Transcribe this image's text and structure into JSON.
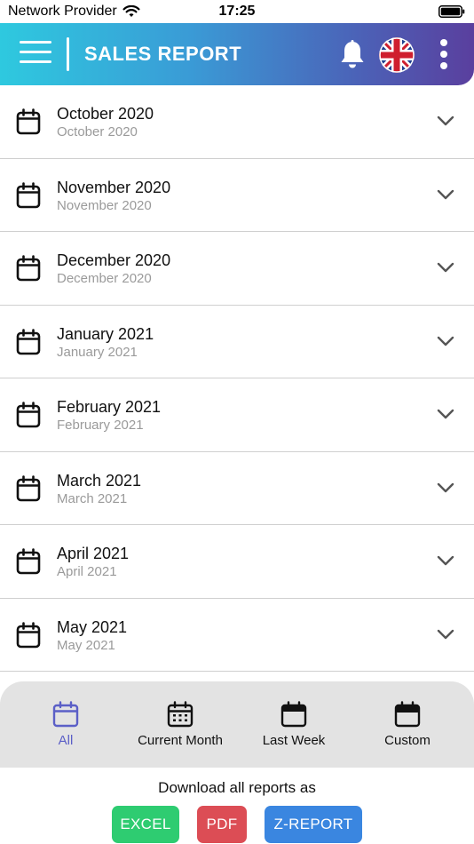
{
  "status": {
    "carrier": "Network Provider",
    "time": "17:25"
  },
  "header": {
    "title": "SALES REPORT",
    "menu_icon": "hamburger-menu-icon",
    "notify_icon": "bell-icon",
    "language_icon": "uk-flag-icon",
    "more_icon": "kebab-icon"
  },
  "reports": [
    {
      "title": "October 2020",
      "subtitle": "October 2020"
    },
    {
      "title": "November 2020",
      "subtitle": "November 2020"
    },
    {
      "title": "December 2020",
      "subtitle": "December 2020"
    },
    {
      "title": "January 2021",
      "subtitle": "January 2021"
    },
    {
      "title": "February 2021",
      "subtitle": "February 2021"
    },
    {
      "title": "March 2021",
      "subtitle": "March 2021"
    },
    {
      "title": "April 2021",
      "subtitle": "April 2021"
    },
    {
      "title": "May 2021",
      "subtitle": "May 2021"
    }
  ],
  "filters": [
    {
      "label": "All",
      "icon": "calendar-outline-icon",
      "active": true
    },
    {
      "label": "Current Month",
      "icon": "calendar-grid-icon",
      "active": false
    },
    {
      "label": "Last Week",
      "icon": "calendar-filled-icon",
      "active": false
    },
    {
      "label": "Custom",
      "icon": "calendar-blank-icon",
      "active": false
    }
  ],
  "download": {
    "label": "Download all reports as",
    "buttons": [
      {
        "label": "EXCEL",
        "color": "#2ecc71"
      },
      {
        "label": "PDF",
        "color": "#dc4d55"
      },
      {
        "label": "Z-REPORT",
        "color": "#3a86e0"
      }
    ]
  },
  "colors": {
    "accent": "#5b5fc7",
    "header_start": "#2ec9df",
    "header_end": "#5a3f9e"
  }
}
